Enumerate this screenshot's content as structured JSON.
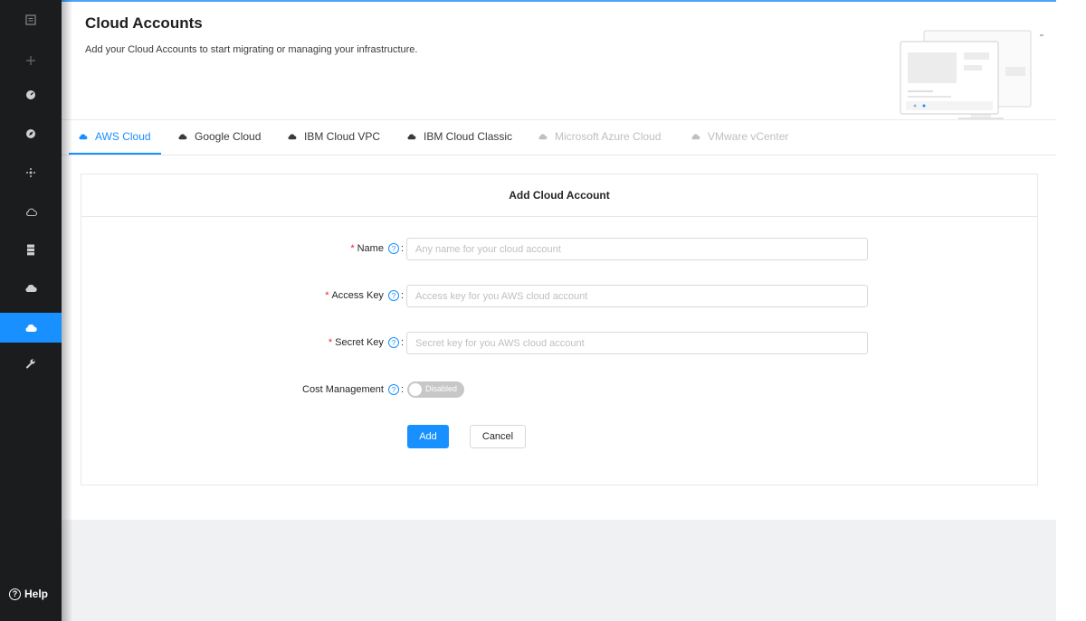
{
  "page": {
    "title": "Cloud Accounts",
    "description": "Add your Cloud Accounts to start migrating or managing your infrastructure."
  },
  "sidebar": {
    "items": [
      {
        "icon": "dashboard-square-icon",
        "active": false
      },
      {
        "icon": "plus-icon",
        "active": false
      },
      {
        "icon": "gauge-icon",
        "active": false
      },
      {
        "icon": "compass-icon",
        "active": false
      },
      {
        "icon": "cluster-icon",
        "active": false
      },
      {
        "icon": "cloud-sync-icon",
        "active": false
      },
      {
        "icon": "server-stack-icon",
        "active": false
      },
      {
        "icon": "cloud-settings-icon",
        "active": false
      },
      {
        "icon": "cloud-icon",
        "active": true
      },
      {
        "icon": "wrench-icon",
        "active": false
      }
    ],
    "help_label": "Help"
  },
  "tabs": [
    {
      "label": "AWS Cloud",
      "state": "active"
    },
    {
      "label": "Google Cloud",
      "state": "normal"
    },
    {
      "label": "IBM Cloud VPC",
      "state": "normal"
    },
    {
      "label": "IBM Cloud Classic",
      "state": "normal"
    },
    {
      "label": "Microsoft Azure Cloud",
      "state": "disabled"
    },
    {
      "label": "VMware vCenter",
      "state": "disabled"
    }
  ],
  "form": {
    "title": "Add Cloud Account",
    "name": {
      "label": "Name",
      "required": "*",
      "value": "",
      "placeholder": "Any name for your cloud account"
    },
    "access_key": {
      "label": "Access Key",
      "required": "*",
      "value": "",
      "placeholder": "Access key for you AWS cloud account"
    },
    "secret_key": {
      "label": "Secret Key",
      "required": "*",
      "value": "",
      "placeholder": "Secret key for you AWS cloud account"
    },
    "cost_management": {
      "label": "Cost Management",
      "state_label": "Disabled",
      "enabled": false
    },
    "info_glyph": "?",
    "colon": ":",
    "add_label": "Add",
    "cancel_label": "Cancel"
  },
  "colors": {
    "accent": "#1890ff",
    "sidebar_bg": "#1b1c1e",
    "required": "#f5222d"
  }
}
